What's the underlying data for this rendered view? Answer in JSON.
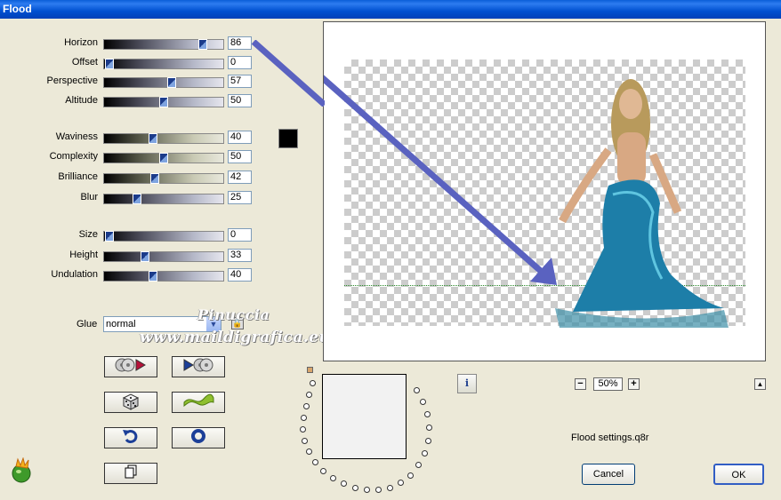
{
  "window": {
    "title": "Flood"
  },
  "sliders_group1": [
    {
      "label": "Horizon",
      "value": "86",
      "level": 86
    },
    {
      "label": "Offset",
      "value": "0",
      "level": 0
    },
    {
      "label": "Perspective",
      "value": "57",
      "level": 57
    },
    {
      "label": "Altitude",
      "value": "50",
      "level": 50
    }
  ],
  "sliders_group2": [
    {
      "label": "Waviness",
      "value": "40",
      "level": 40
    },
    {
      "label": "Complexity",
      "value": "50",
      "level": 50
    },
    {
      "label": "Brilliance",
      "value": "42",
      "level": 42
    },
    {
      "label": "Blur",
      "value": "25",
      "level": 25
    }
  ],
  "sliders_group3": [
    {
      "label": "Size",
      "value": "0",
      "level": 0
    },
    {
      "label": "Height",
      "value": "33",
      "level": 33
    },
    {
      "label": "Undulation",
      "value": "40",
      "level": 40
    }
  ],
  "water_color": "#000000",
  "glue": {
    "label": "Glue",
    "value": "normal"
  },
  "watermark": {
    "line1": "Pinuccia",
    "line2": "www.maildigrafica.eu"
  },
  "preview": {
    "zoom": "50%"
  },
  "settings_file": "Flood settings.q8r",
  "buttons": {
    "cancel": "Cancel",
    "ok": "OK"
  },
  "colors": {
    "arrow": "#5a62c0",
    "title_bar": "#0a5fd8"
  }
}
